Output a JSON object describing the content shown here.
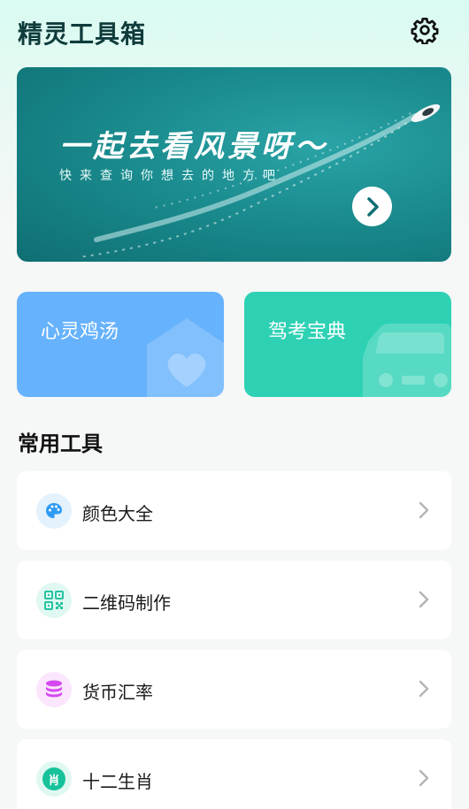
{
  "header": {
    "title": "精灵工具箱",
    "settings_icon": "gear-icon"
  },
  "banner": {
    "title": "一起去看风景呀～",
    "subtitle": "快来查询你想去的地方吧",
    "button_icon": "chevron-right-icon"
  },
  "cards": [
    {
      "label": "心灵鸡汤",
      "icon": "house-heart-icon",
      "color": "#67b2fd"
    },
    {
      "label": "驾考宝典",
      "icon": "car-icon",
      "color": "#2ed1b4"
    }
  ],
  "section": {
    "title": "常用工具"
  },
  "tools": [
    {
      "label": "颜色大全",
      "icon": "palette-icon",
      "icon_color": "#2f9bf4",
      "icon_bg": "#e3f2fd"
    },
    {
      "label": "二维码制作",
      "icon": "qrcode-icon",
      "icon_color": "#25c3a0",
      "icon_bg": "#dff8f1"
    },
    {
      "label": "货币汇率",
      "icon": "coins-icon",
      "icon_color": "#d448f0",
      "icon_bg": "#fbe6fd"
    },
    {
      "label": "十二生肖",
      "icon": "zodiac-icon",
      "icon_glyph": "肖",
      "icon_color": "#17c29a",
      "icon_bg": "#dff8f1"
    }
  ]
}
